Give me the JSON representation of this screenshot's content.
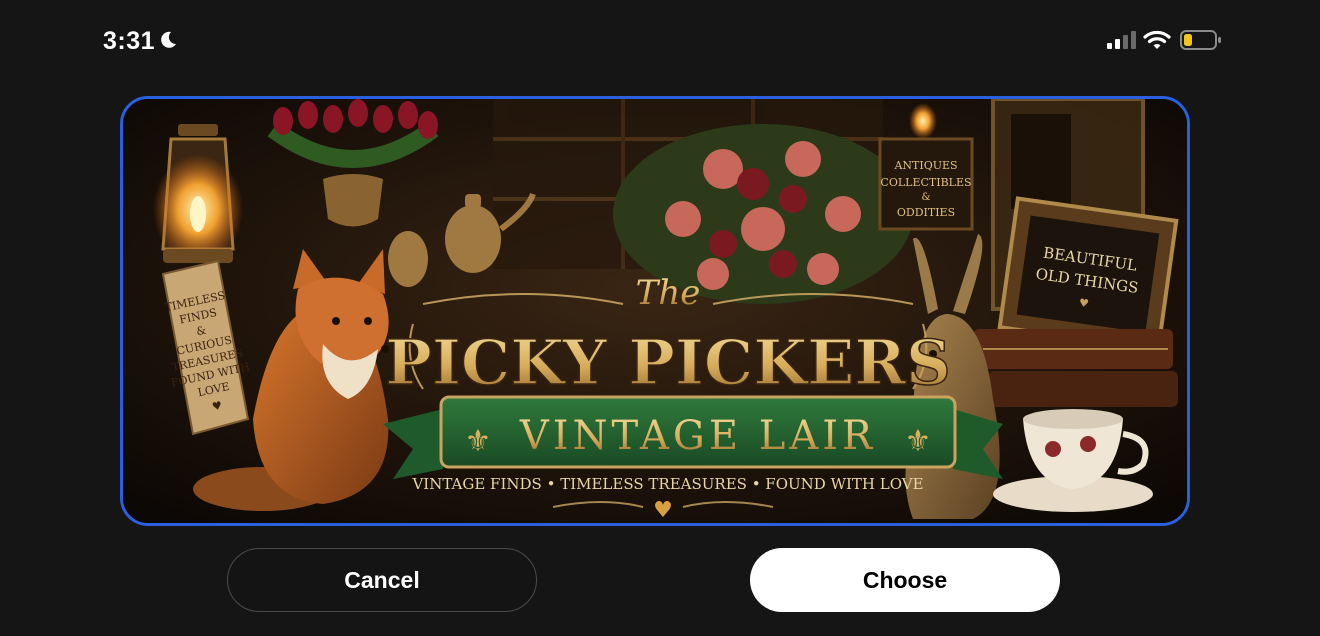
{
  "status_bar": {
    "time": "3:31",
    "focus_icon": "moon-icon",
    "signal_icon": "cellular-signal-icon",
    "wifi_icon": "wifi-icon",
    "battery_icon": "battery-low-icon",
    "battery_color": "#f5c518"
  },
  "image": {
    "tag_text": [
      "TIMELESS",
      "FINDS",
      "&",
      "CURIOUS",
      "TREASURES",
      "FOUND WITH",
      "LOVE"
    ],
    "shop_sign_text": [
      "ANTIQUES",
      "COLLECTIBLES",
      "&",
      "ODDITIES"
    ],
    "frame_text": [
      "BEAUTIFUL",
      "OLD THINGS"
    ],
    "title_the": "The",
    "title_main": "PICKY PICKERS",
    "title_banner": "VINTAGE LAIR",
    "tagline": "VINTAGE FINDS • TIMELESS TREASURES • FOUND WITH LOVE",
    "frame_color": "#2a5fe0"
  },
  "actions": {
    "cancel_label": "Cancel",
    "choose_label": "Choose"
  }
}
